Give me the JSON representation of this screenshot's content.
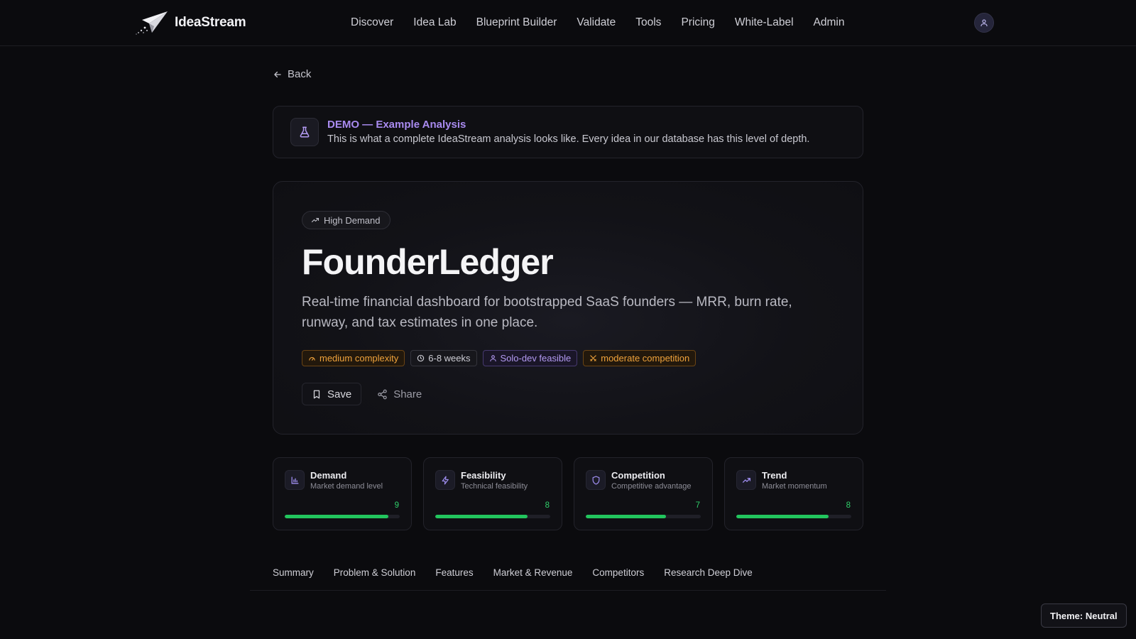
{
  "header": {
    "brand_name": "IdeaStream",
    "brand_icon": "paper-plane-icon",
    "nav": [
      {
        "label": "Discover"
      },
      {
        "label": "Idea Lab"
      },
      {
        "label": "Blueprint Builder"
      },
      {
        "label": "Validate"
      },
      {
        "label": "Tools"
      },
      {
        "label": "Pricing"
      },
      {
        "label": "White-Label"
      },
      {
        "label": "Admin"
      }
    ],
    "avatar_icon": "user-icon"
  },
  "back": {
    "label": "Back",
    "icon": "arrow-left-icon"
  },
  "demo_banner": {
    "icon": "flask-icon",
    "title": "DEMO — Example Analysis",
    "text": "This is what a complete IdeaStream analysis looks like. Every idea in our database has this level of depth."
  },
  "idea": {
    "badge": "High Demand",
    "badge_icon": "trending-up-icon",
    "title": "FounderLedger",
    "description": "Real-time financial dashboard for bootstrapped SaaS founders — MRR, burn rate, runway, and tax estimates in one place.",
    "chips": [
      {
        "label": "medium complexity",
        "icon": "gauge-icon",
        "color": "#f0a33b"
      },
      {
        "label": "6-8 weeks",
        "icon": "clock-icon",
        "color": "#cfcfd6"
      },
      {
        "label": "Solo-dev feasible",
        "icon": "user-icon",
        "color": "#b39af2"
      },
      {
        "label": "moderate competition",
        "icon": "swords-icon",
        "color": "#f0a33b"
      }
    ],
    "save_label": "Save",
    "share_label": "Share"
  },
  "metrics": [
    {
      "title": "Demand",
      "subtitle": "Market demand level",
      "value": "9",
      "score": 9,
      "max": 10,
      "icon": "bar-chart-icon"
    },
    {
      "title": "Feasibility",
      "subtitle": "Technical feasibility",
      "value": "8",
      "score": 8,
      "max": 10,
      "icon": "lightning-icon"
    },
    {
      "title": "Competition",
      "subtitle": "Competitive advantage",
      "value": "7",
      "score": 7,
      "max": 10,
      "icon": "shield-icon"
    },
    {
      "title": "Trend",
      "subtitle": "Market momentum",
      "value": "8",
      "score": 8,
      "max": 10,
      "icon": "trending-up-icon"
    }
  ],
  "tabs": [
    {
      "label": "Summary"
    },
    {
      "label": "Problem & Solution"
    },
    {
      "label": "Features"
    },
    {
      "label": "Market & Revenue"
    },
    {
      "label": "Competitors"
    },
    {
      "label": "Research Deep Dive"
    }
  ],
  "theme_button": {
    "label": "Theme: Neutral"
  },
  "colors": {
    "accent_purple": "#a98bf0",
    "score_green": "#22c55e",
    "background": "#0b0b0e"
  }
}
